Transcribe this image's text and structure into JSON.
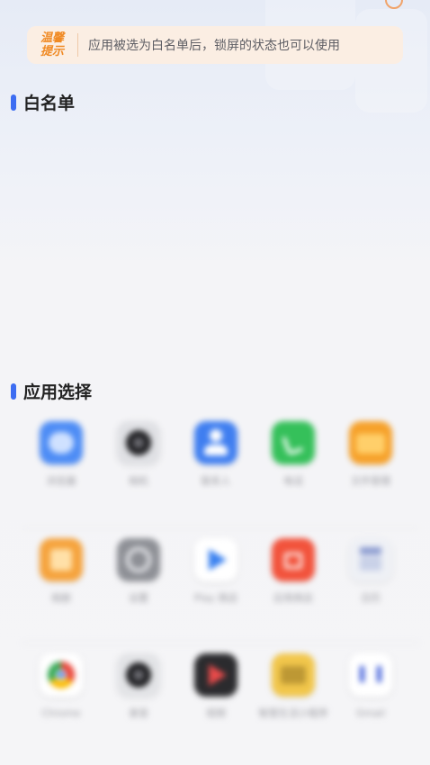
{
  "tip": {
    "badge_line1": "温馨",
    "badge_line2": "提示",
    "text": "应用被选为白名单后，锁屏的状态也可以使用"
  },
  "sections": {
    "whitelist_title": "白名单",
    "app_select_title": "应用选择"
  },
  "colors": {
    "accent": "#3d6df2",
    "tip_bg": "#fbeee3",
    "tip_badge": "#f08a24"
  },
  "apps": [
    {
      "label": "浏览器",
      "icon": "browser-icon",
      "color": "#4d8cf5"
    },
    {
      "label": "相机",
      "icon": "camera-icon",
      "color": "#dfe0e4"
    },
    {
      "label": "联系人",
      "icon": "contacts-icon",
      "color": "#3f7ef0"
    },
    {
      "label": "电话",
      "icon": "phone-icon",
      "color": "#35c05a"
    },
    {
      "label": "文件管理",
      "icon": "folder-icon",
      "color": "#f6a12a"
    },
    {
      "label": "相册",
      "icon": "gallery-icon",
      "color": "#f5a33d"
    },
    {
      "label": "设置",
      "icon": "settings-icon",
      "color": "#8e9096"
    },
    {
      "label": "Play 商店",
      "icon": "play-store-icon",
      "color": "#ffffff"
    },
    {
      "label": "应用商店",
      "icon": "app-store-icon",
      "color": "#f2533c"
    },
    {
      "label": "日历",
      "icon": "calendar-icon",
      "color": "#eef0f5"
    },
    {
      "label": "Chrome",
      "icon": "chrome-icon",
      "color": "#ffffff"
    },
    {
      "label": "录音",
      "icon": "recorder-icon",
      "color": "#e2e3e6"
    },
    {
      "label": "视频",
      "icon": "video-icon",
      "color": "#2b2b2e"
    },
    {
      "label": "智慧生活小程序",
      "icon": "mini-program-icon",
      "color": "#f1c64b"
    },
    {
      "label": "Gmail",
      "icon": "gmail-icon",
      "color": "#ffffff"
    }
  ]
}
